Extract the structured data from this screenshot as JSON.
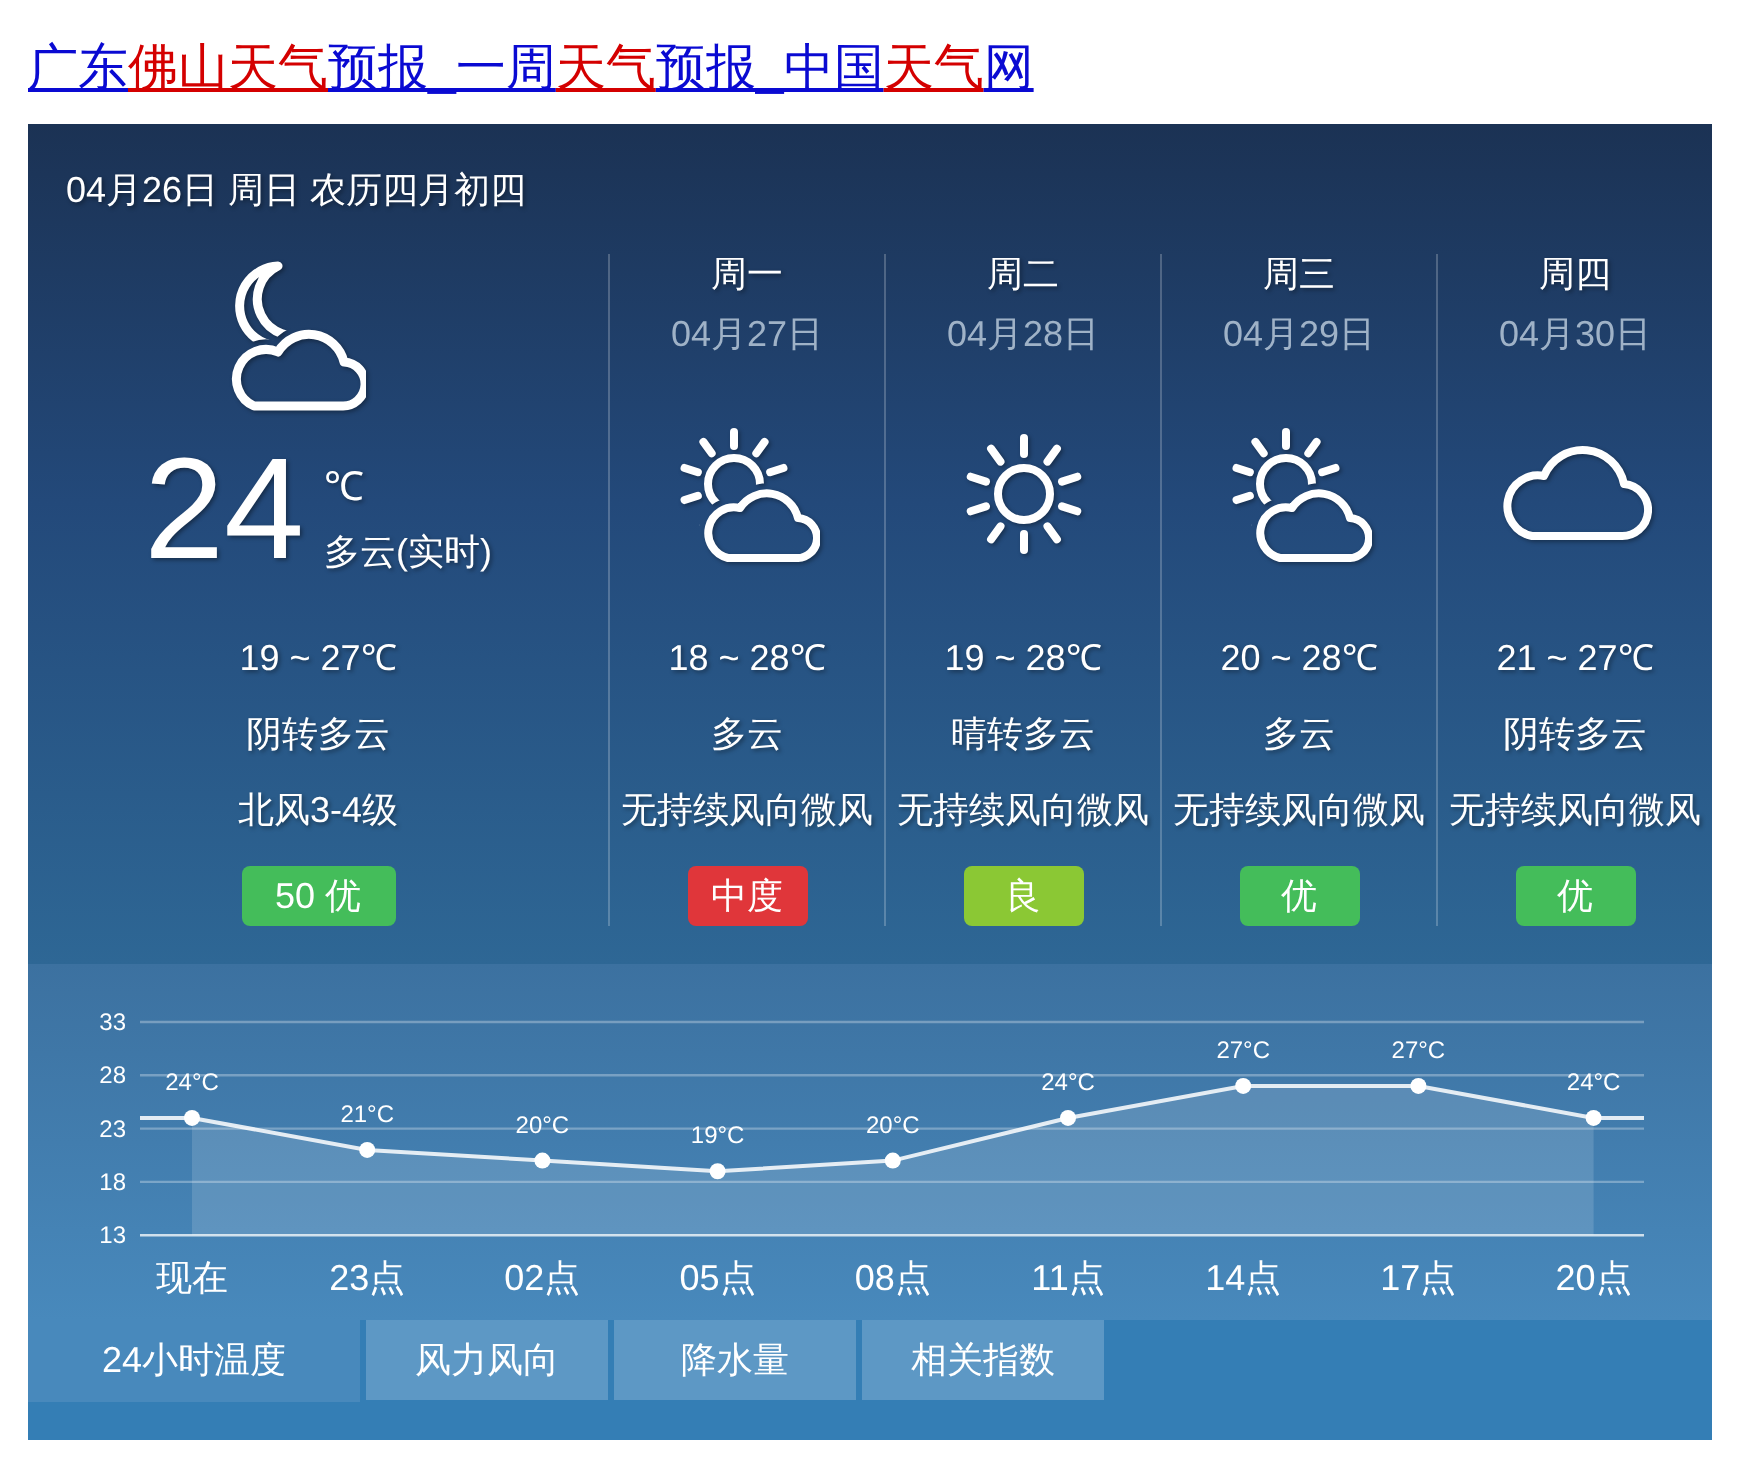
{
  "title_link": {
    "segments": [
      {
        "text": "广东",
        "highlight": false
      },
      {
        "text": "佛山天气",
        "highlight": true
      },
      {
        "text": "预报_一周",
        "highlight": false
      },
      {
        "text": "天气",
        "highlight": true
      },
      {
        "text": "预报_中国",
        "highlight": false
      },
      {
        "text": "天气",
        "highlight": true
      },
      {
        "text": "网",
        "highlight": false
      }
    ]
  },
  "widget": {
    "header_date": "04月26日 周日 农历四月初四",
    "current": {
      "temperature": "24",
      "unit": "℃",
      "condition": "多云(实时)",
      "range": "19 ~ 27℃",
      "weather": "阴转多云",
      "wind": "北风3-4级",
      "aqi": {
        "text": "50 优",
        "color": "#44bd5a"
      }
    },
    "forecast": [
      {
        "day": "周一",
        "date": "04月27日",
        "kind": "partlycloudy",
        "range": "18 ~ 28℃",
        "weather": "多云",
        "wind": "无持续风向微风",
        "aqi": {
          "text": "中度",
          "color": "#e0363a"
        }
      },
      {
        "day": "周二",
        "date": "04月28日",
        "kind": "sunny",
        "range": "19 ~ 28℃",
        "weather": "晴转多云",
        "wind": "无持续风向微风",
        "aqi": {
          "text": "良",
          "color": "#8bc834"
        }
      },
      {
        "day": "周三",
        "date": "04月29日",
        "kind": "partlycloudy",
        "range": "20 ~ 28℃",
        "weather": "多云",
        "wind": "无持续风向微风",
        "aqi": {
          "text": "优",
          "color": "#44bd5a"
        }
      },
      {
        "day": "周四",
        "date": "04月30日",
        "kind": "cloudy",
        "range": "21 ~ 27℃",
        "weather": "阴转多云",
        "wind": "无持续风向微风",
        "aqi": {
          "text": "优",
          "color": "#44bd5a"
        }
      }
    ],
    "chart": {
      "chart_data": {
        "type": "area",
        "categories": [
          "现在",
          "23点",
          "02点",
          "05点",
          "08点",
          "11点",
          "14点",
          "17点",
          "20点"
        ],
        "series": [
          {
            "values": [
              24,
              21,
              20,
              19,
              20,
              24,
              27,
              27,
              24
            ]
          }
        ],
        "ylim": [
          13,
          33
        ],
        "yticks": [
          13,
          18,
          23,
          28,
          33
        ],
        "grid": true,
        "value_labels": [
          "24°C",
          "21°C",
          "20°C",
          "19°C",
          "20°C",
          "24°C",
          "27°C",
          "27°C",
          "24°C"
        ]
      }
    },
    "tabs": [
      {
        "label": "24小时温度",
        "selected": true
      },
      {
        "label": "风力风向",
        "selected": false
      },
      {
        "label": "降水量",
        "selected": false
      },
      {
        "label": "相关指数",
        "selected": false
      }
    ]
  }
}
